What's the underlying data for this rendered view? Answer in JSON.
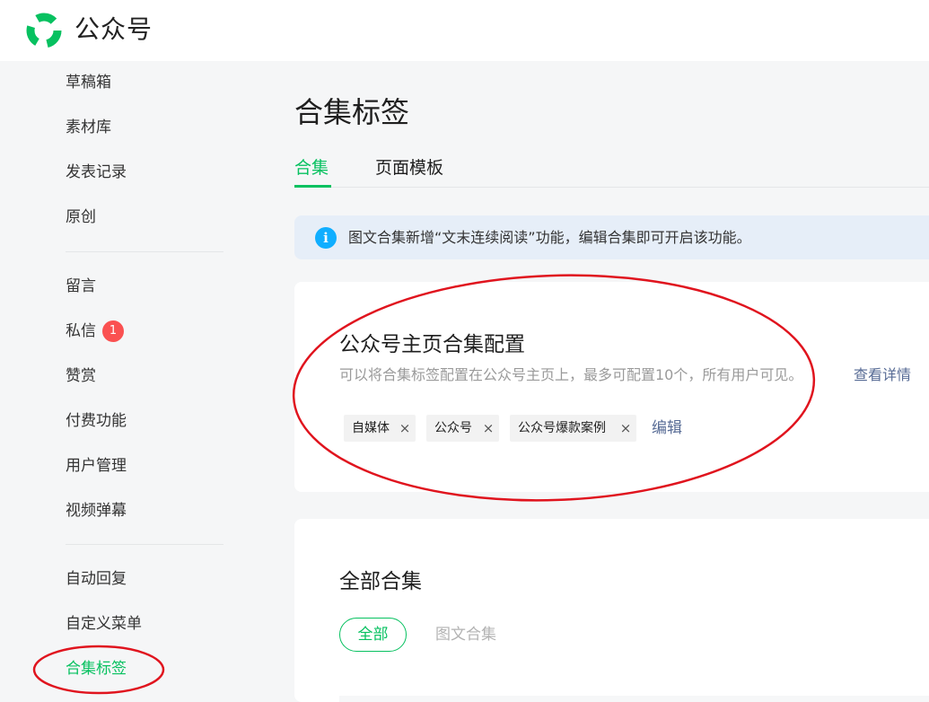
{
  "header": {
    "brand_name": "公众号",
    "logo_icon": "wechat-official-account-logo"
  },
  "sidebar": {
    "group1": [
      {
        "label": "草稿箱"
      },
      {
        "label": "素材库"
      },
      {
        "label": "发表记录"
      },
      {
        "label": "原创"
      }
    ],
    "group2": [
      {
        "label": "留言"
      },
      {
        "label": "私信",
        "badge": "1"
      },
      {
        "label": "赞赏"
      },
      {
        "label": "付费功能"
      },
      {
        "label": "用户管理"
      },
      {
        "label": "视频弹幕"
      }
    ],
    "group3": [
      {
        "label": "自动回复"
      },
      {
        "label": "自定义菜单"
      },
      {
        "label": "合集标签",
        "active": true
      }
    ]
  },
  "main": {
    "title": "合集标签",
    "tabs": [
      {
        "label": "合集",
        "active": true
      },
      {
        "label": "页面模板"
      }
    ],
    "notice": {
      "icon": "info-icon",
      "icon_glyph": "i",
      "text": "图文合集新增“文末连续阅读”功能，编辑合集即可开启该功能。"
    },
    "homepage_config": {
      "title": "公众号主页合集配置",
      "description": "可以将合集标签配置在公众号主页上，最多可配置10个，所有用户可见。",
      "details_link": "查看详情",
      "tags": [
        {
          "label": "自媒体"
        },
        {
          "label": "公众号"
        },
        {
          "label": "公众号爆款案例"
        }
      ],
      "edit_label": "编辑"
    },
    "all_collections": {
      "title": "全部合集",
      "filters": [
        {
          "label": "全部",
          "active": true
        },
        {
          "label": "图文合集"
        }
      ]
    }
  },
  "colors": {
    "brand_green": "#07c160",
    "link_blue": "#576b95",
    "badge_red": "#fa5151",
    "info_blue": "#10aeff",
    "annotation_red": "#e0141e"
  }
}
